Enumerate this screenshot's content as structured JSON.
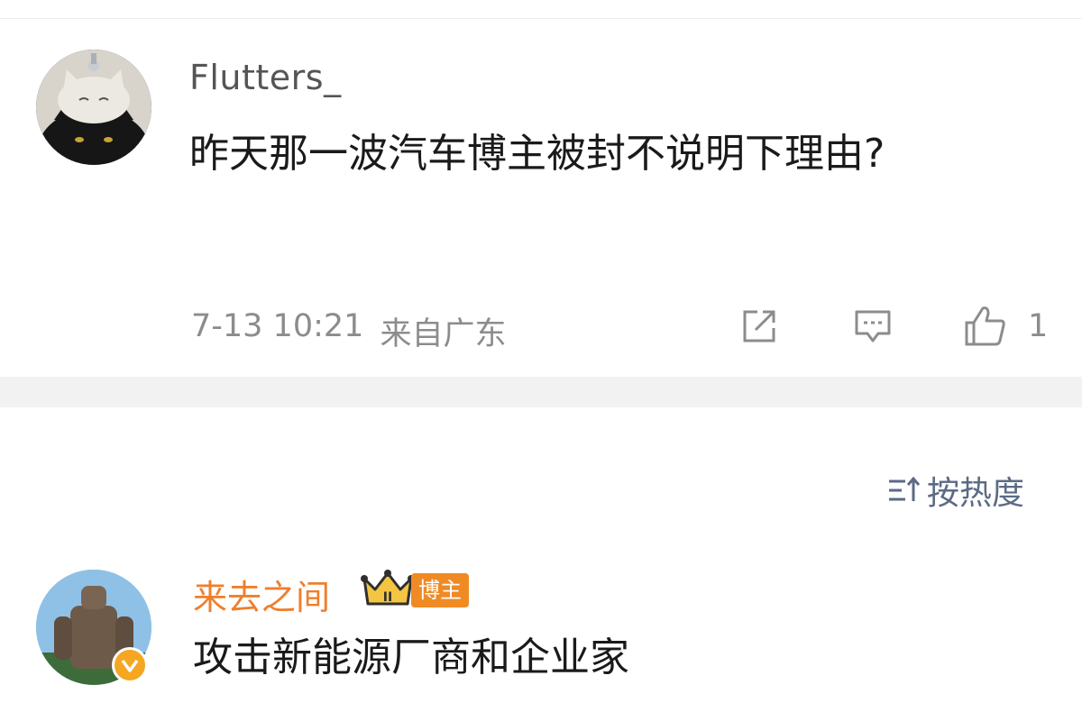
{
  "post": {
    "username": "Flutters_",
    "content": "昨天那一波汽车博主被封不说明下理由?",
    "timestamp": "7-13 10:21",
    "location": "来自广东",
    "like_count": "1"
  },
  "sort": {
    "label": "按热度"
  },
  "comment": {
    "username": "来去之间",
    "level_badge": "II",
    "role_badge": "博主",
    "text": "攻击新能源厂商和企业家"
  },
  "colors": {
    "accent_blue": "#5b6b85",
    "username_orange": "#ee7f2d",
    "badge_orange": "#f08a24",
    "verify_gold": "#f5a623"
  }
}
